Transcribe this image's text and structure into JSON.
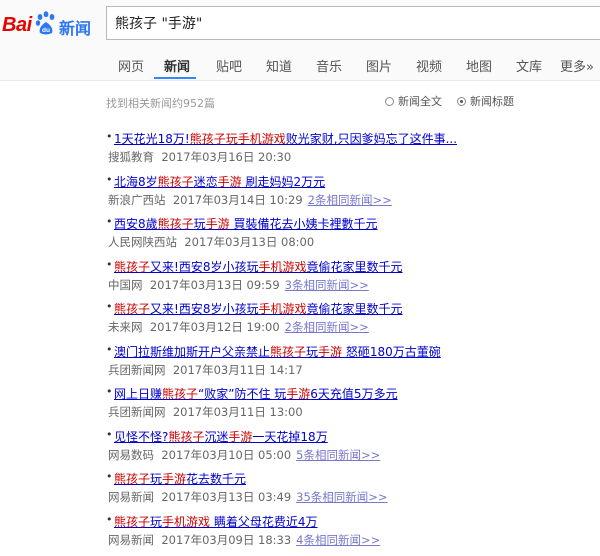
{
  "logo": {
    "bai": "Bai",
    "du": "du",
    "news": "新闻"
  },
  "search": {
    "query": "熊孩子 \"手游\""
  },
  "nav": {
    "tabs": [
      "网页",
      "新闻",
      "贴吧",
      "知道",
      "音乐",
      "图片",
      "视频",
      "地图",
      "文库",
      "更多»"
    ],
    "active_index": 1
  },
  "info": {
    "result_count": "找到相关新闻约952篇",
    "option_full": "新闻全文",
    "option_title": "新闻标题",
    "selected_option": "新闻标题"
  },
  "results": [
    {
      "title": [
        [
          "1天花光18万!",
          0
        ],
        [
          "熊孩子",
          1
        ],
        [
          "玩手机游戏",
          1
        ],
        [
          "败光家财,只因爹妈忘了这件事...",
          0
        ]
      ],
      "source": "搜狐教育",
      "time": "2017年03月16日 20:30",
      "same": ""
    },
    {
      "title": [
        [
          "北海8岁",
          0
        ],
        [
          "熊孩子",
          1
        ],
        [
          "迷恋",
          0
        ],
        [
          "手游",
          1
        ],
        [
          " 刷走妈妈2万元",
          0
        ]
      ],
      "source": "新浪广西站",
      "time": "2017年03月14日 10:29",
      "same": "2条相同新闻>>"
    },
    {
      "title": [
        [
          "西安8歲",
          0
        ],
        [
          "熊孩子",
          1
        ],
        [
          "玩",
          0
        ],
        [
          "手游",
          1
        ],
        [
          " 買裝備花去小姨卡裡數千元",
          0
        ]
      ],
      "source": "人民网陕西站",
      "time": "2017年03月13日 08:00",
      "same": ""
    },
    {
      "title": [
        [
          "熊孩子",
          1
        ],
        [
          "又来!西安8岁小孩玩",
          0
        ],
        [
          "手机游戏",
          1
        ],
        [
          "竟偷花家里数千元",
          0
        ]
      ],
      "source": "中国网",
      "time": "2017年03月13日 09:59",
      "same": "3条相同新闻>>"
    },
    {
      "title": [
        [
          "熊孩子",
          1
        ],
        [
          "又来!西安8岁小孩玩",
          0
        ],
        [
          "手机游戏",
          1
        ],
        [
          "竟偷花家里数千元",
          0
        ]
      ],
      "source": "未来网",
      "time": "2017年03月12日 19:00",
      "same": "2条相同新闻>>"
    },
    {
      "title": [
        [
          "澳门拉斯维加斯开户父亲禁止",
          0
        ],
        [
          "熊孩子",
          1
        ],
        [
          "玩",
          0
        ],
        [
          "手游",
          1
        ],
        [
          " 怒砸180万古董碗",
          0
        ]
      ],
      "source": "兵团新闻网",
      "time": "2017年03月11日 14:17",
      "same": ""
    },
    {
      "title": [
        [
          "网上日赚",
          0
        ],
        [
          "熊孩子",
          1
        ],
        [
          "“败家”防不住 玩",
          0
        ],
        [
          "手游",
          1
        ],
        [
          "6天充值5万多元",
          0
        ]
      ],
      "source": "兵团新闻网",
      "time": "2017年03月11日 13:00",
      "same": ""
    },
    {
      "title": [
        [
          "见怪不怪?",
          0
        ],
        [
          "熊孩子",
          1
        ],
        [
          "沉迷",
          0
        ],
        [
          "手游",
          1
        ],
        [
          "一天花掉18万",
          0
        ]
      ],
      "source": "网易数码",
      "time": "2017年03月10日 05:00",
      "same": "5条相同新闻>>"
    },
    {
      "title": [
        [
          "熊孩子",
          1
        ],
        [
          "玩",
          0
        ],
        [
          "手游",
          1
        ],
        [
          "花去数千元",
          0
        ]
      ],
      "source": "网易新闻",
      "time": "2017年03月13日 03:49",
      "same": "35条相同新闻>>"
    },
    {
      "title": [
        [
          "熊孩子",
          1
        ],
        [
          "玩",
          0
        ],
        [
          "手机游戏",
          1
        ],
        [
          " 瞒着父母花费近4万",
          0
        ]
      ],
      "source": "网易新闻",
      "time": "2017年03月09日 18:33",
      "same": "4条相同新闻>>"
    }
  ],
  "colors": {
    "brand_red": "#e10601",
    "brand_blue": "#2d78f4",
    "link": "#0000cc",
    "highlight": "#cc0000",
    "tab_underline": "#3388ff"
  }
}
